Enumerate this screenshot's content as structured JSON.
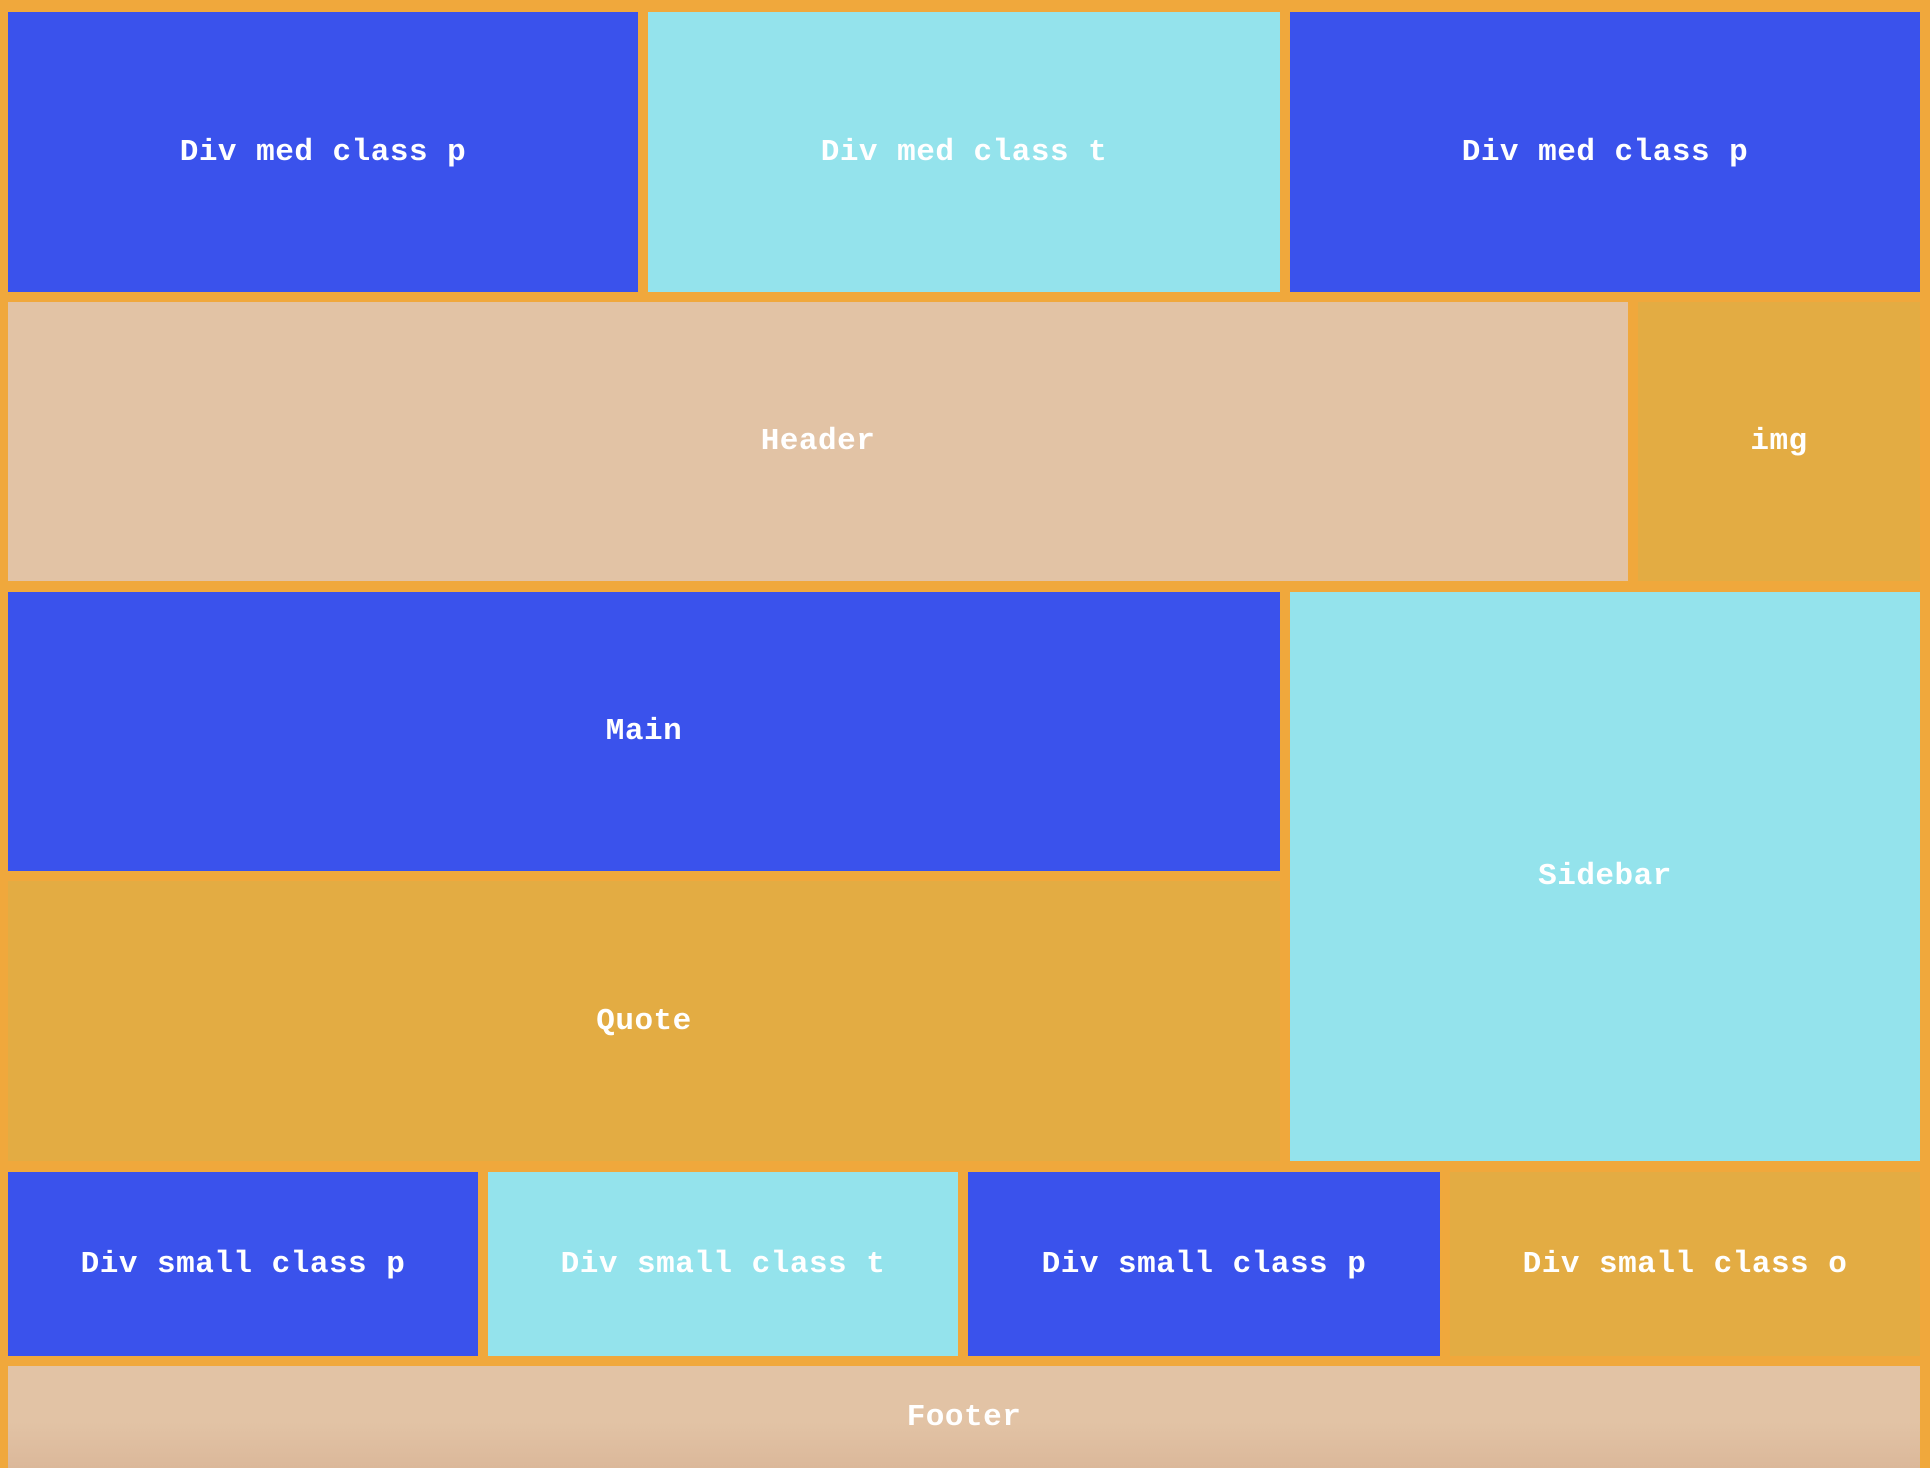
{
  "row1": {
    "left_label": "Div med class p",
    "middle_label": "Div med class t",
    "right_label": "Div med class p"
  },
  "row2": {
    "header_label": "Header",
    "img_label": "img"
  },
  "content": {
    "main_label": "Main",
    "quote_label": "Quote",
    "sidebar_label": "Sidebar"
  },
  "row_small": {
    "first_label": "Div small class p",
    "second_label": "Div small class t",
    "third_label": "Div small class p",
    "fourth_label": "Div small class o"
  },
  "footer": {
    "label": "Footer"
  },
  "colors": {
    "background": "#f0a83c",
    "class_p": "#3a52ec",
    "class_t": "#94e3ec",
    "class_o": "#e3ac43",
    "header_footer": "#e2c3a5",
    "text": "#ffffff"
  }
}
